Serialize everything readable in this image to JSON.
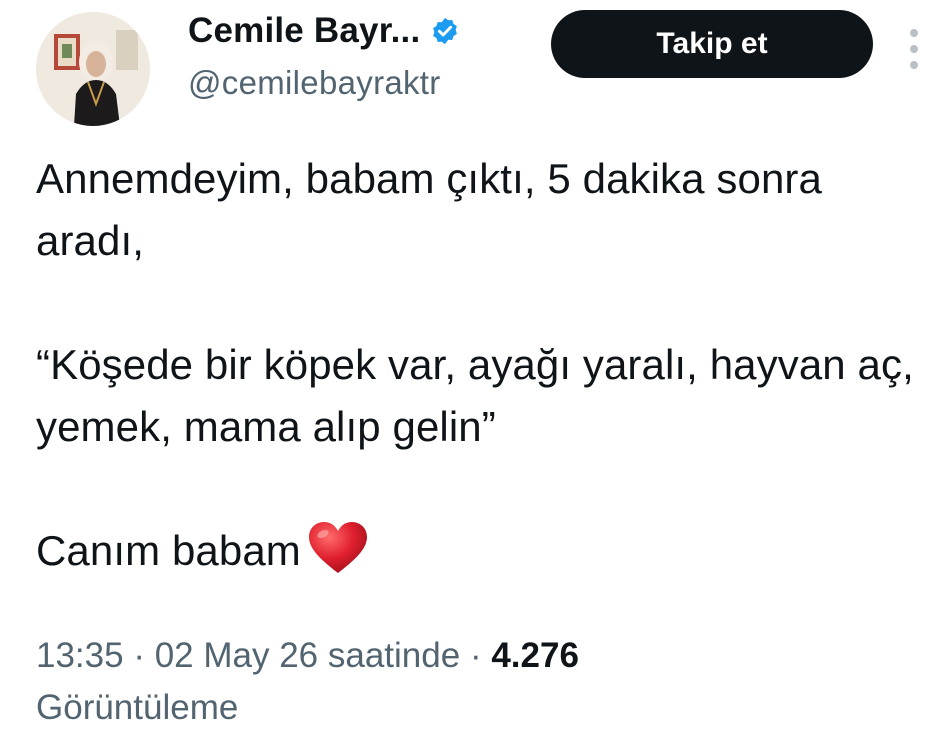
{
  "user": {
    "display_name": "Cemile Bayr...",
    "handle": "@cemilebayraktr",
    "verified": true,
    "verified_color": "#1d9bf0"
  },
  "follow_button": {
    "label": "Takip et"
  },
  "more_icon": "vertical-ellipsis-icon",
  "tweet": {
    "lines": [
      "Annemdeyim, babam çıktı, 5 dakika sonra aradı,",
      "“Köşede bir köpek var, ayağı yaralı, hayvan aç, yemek, mama alıp gelin”",
      "Canım babam"
    ],
    "emoji": "red-heart-icon",
    "heart_color": "#e0202e"
  },
  "meta": {
    "time": "13:35",
    "separator": "·",
    "date_text": "02 May 26 saatinde",
    "views_count": "4.276",
    "views_label": "Görüntüleme"
  }
}
